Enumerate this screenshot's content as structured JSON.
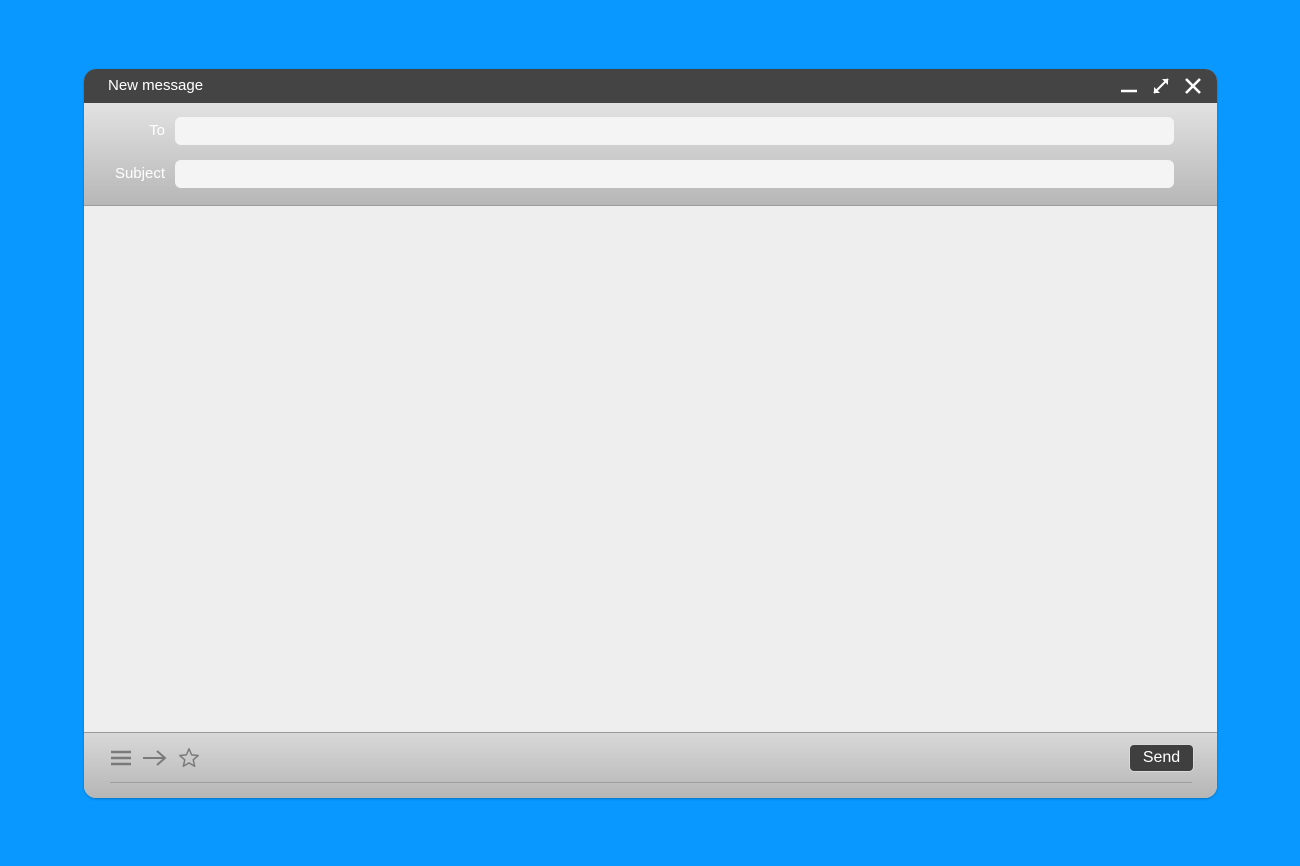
{
  "window": {
    "title": "New message"
  },
  "fields": {
    "to": {
      "label": "To",
      "value": ""
    },
    "subject": {
      "label": "Subject",
      "value": ""
    }
  },
  "body": {
    "value": ""
  },
  "toolbar": {
    "send_label": "Send"
  },
  "icons": {
    "minimize": "minimize-icon",
    "maximize": "expand-icon",
    "close": "close-icon",
    "menu": "menu-icon",
    "forward": "arrow-right-icon",
    "favorite": "star-icon"
  },
  "colors": {
    "background": "#0898FF",
    "titlebar": "#444444",
    "send_button": "#3F3F3F"
  }
}
